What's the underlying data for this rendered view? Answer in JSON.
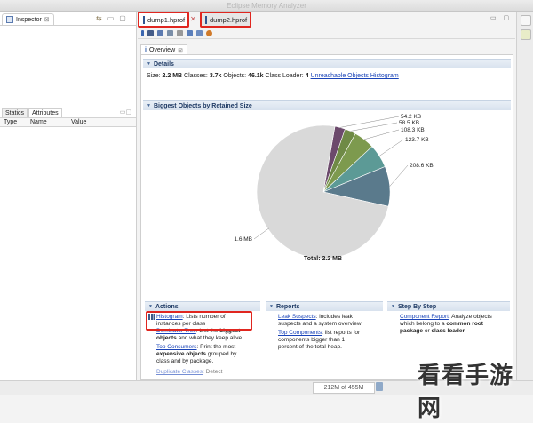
{
  "window": {
    "title": "Eclipse Memory Analyzer"
  },
  "inspector": {
    "tab_label": "Inspector",
    "sub_tabs": [
      "Statics",
      "Attributes"
    ],
    "columns": [
      "Type",
      "Name",
      "Value"
    ]
  },
  "editor_tabs": [
    {
      "label": "dump1.hprof",
      "active": true
    },
    {
      "label": "dump2.hprof",
      "active": false
    }
  ],
  "overview_tab": {
    "label": "Overview"
  },
  "details": {
    "heading": "Details",
    "size_label": "Size:",
    "size_value": "2.2 MB",
    "classes_label": "Classes:",
    "classes_value": "3.7k",
    "objects_label": "Objects:",
    "objects_value": "46.1k",
    "loader_label": "Class Loader:",
    "loader_value": "4",
    "unreachable_link": "Unreachable Objects Histogram"
  },
  "biggest": {
    "heading": "Biggest Objects by Retained Size",
    "total_label": "Total: 2.2 MB"
  },
  "chart_data": {
    "type": "pie",
    "slices": [
      {
        "label": "1.6 MB",
        "value": 1600,
        "color": "#d9d9d9"
      },
      {
        "label": "208.6 KB",
        "value": 208.6,
        "color": "#5a7a8c"
      },
      {
        "label": "123.7 KB",
        "value": 123.7,
        "color": "#5c9a96"
      },
      {
        "label": "108.3 KB",
        "value": 108.3,
        "color": "#7d9a4e"
      },
      {
        "label": "58.5 KB",
        "value": 58.5,
        "color": "#6f8a46"
      },
      {
        "label": "54.2 KB",
        "value": 54.2,
        "color": "#6c4a6c"
      }
    ],
    "total": "Total: 2.2 MB"
  },
  "actions": {
    "heading": "Actions",
    "histogram_link": "Histogram",
    "histogram_desc_1": ": Lists number of",
    "histogram_desc_2": "instances per class",
    "dominator_link": "Dominator Tree",
    "dominator_desc_1": ": List the",
    "dominator_bold_1": "biggest",
    "dominator_bold_2": "objects",
    "dominator_desc_2": "and what they keep alive.",
    "consumers_link": "Top Consumers",
    "consumers_desc_1": ": Print the most",
    "consumers_bold": "expensive objects",
    "consumers_desc_2": "grouped by",
    "consumers_desc_3": "class and by package.",
    "duplicate_link": "Duplicate Classes",
    "duplicate_desc": ": Detect"
  },
  "reports": {
    "heading": "Reports",
    "leak_link": "Leak Suspects",
    "leak_desc_1": ": includes leak",
    "leak_desc_2": "suspects and a system overview",
    "topcomp_link": "Top Components",
    "topcomp_desc_1": ": list reports for",
    "topcomp_desc_2": "components bigger than 1",
    "topcomp_desc_3": "percent of the total heap."
  },
  "stepbystep": {
    "heading": "Step By Step",
    "component_link": "Component Report",
    "component_desc_1": ": Analyze objects",
    "component_desc_2": "which belong to a",
    "component_bold_1": "common root",
    "component_bold_2": "package",
    "component_desc_3": "or",
    "component_bold_3": "class loader."
  },
  "status": {
    "heap": "212M of 455M"
  },
  "watermark": "看看手游网"
}
